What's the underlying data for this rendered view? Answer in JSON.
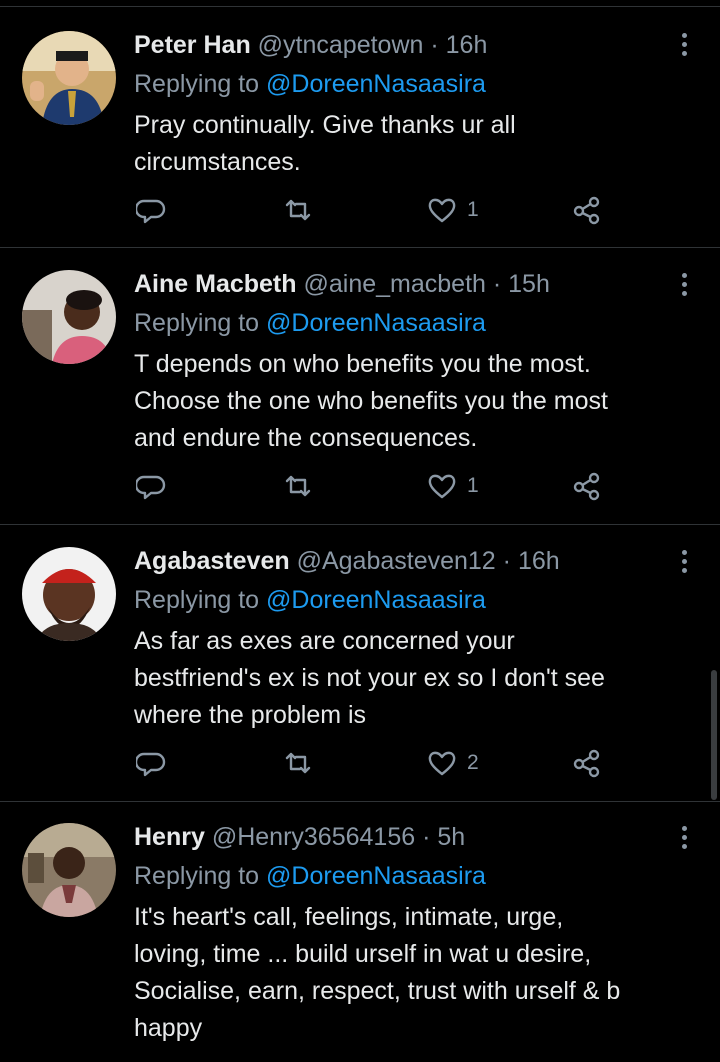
{
  "tweets": [
    {
      "name": "Peter Han",
      "handle": "@ytncapetown",
      "dot": "·",
      "time": "16h",
      "reply_prefix": "Replying to",
      "reply_to": "@DoreenNasaasira",
      "lines": [
        "Pray continually. Give thanks ur all",
        "circumstances."
      ],
      "likes": "1",
      "avatar_icon": "avatar-peter-han"
    },
    {
      "name": "Aine Macbeth",
      "handle": "@aine_macbeth",
      "dot": "·",
      "time": "15h",
      "reply_prefix": "Replying to",
      "reply_to": "@DoreenNasaasira",
      "lines": [
        "T depends on who benefits you the most.",
        "Choose the one who benefits you the most",
        "and endure the consequences."
      ],
      "likes": "1",
      "avatar_icon": "avatar-aine-macbeth"
    },
    {
      "name": "Agabasteven",
      "handle": "@Agabasteven12",
      "dot": "·",
      "time": "16h",
      "reply_prefix": "Replying to",
      "reply_to": "@DoreenNasaasira",
      "lines": [
        "As far as exes are concerned your",
        "bestfriend's ex is not your ex so I don't see",
        "where the problem is"
      ],
      "likes": "2",
      "avatar_icon": "avatar-agabasteven"
    },
    {
      "name": "Henry",
      "handle": "@Henry36564156",
      "dot": "·",
      "time": "5h",
      "reply_prefix": "Replying to",
      "reply_to": "@DoreenNasaasira",
      "lines": [
        "It's heart's call, feelings, intimate, urge,",
        "loving, time ... build urself in wat u desire,",
        "Socialise, earn, respect, trust with urself & b",
        "happy"
      ],
      "likes": "",
      "avatar_icon": "avatar-henry"
    }
  ],
  "icons": {
    "reply": "comment-icon",
    "retweet": "retweet-icon",
    "like": "heart-icon",
    "share": "share-icon",
    "more": "more-vertical-icon"
  },
  "colors": {
    "background": "#000000",
    "text": "#e7e9ea",
    "muted": "#8b98a5",
    "link": "#1d9bf0",
    "divider": "#2f3336"
  }
}
